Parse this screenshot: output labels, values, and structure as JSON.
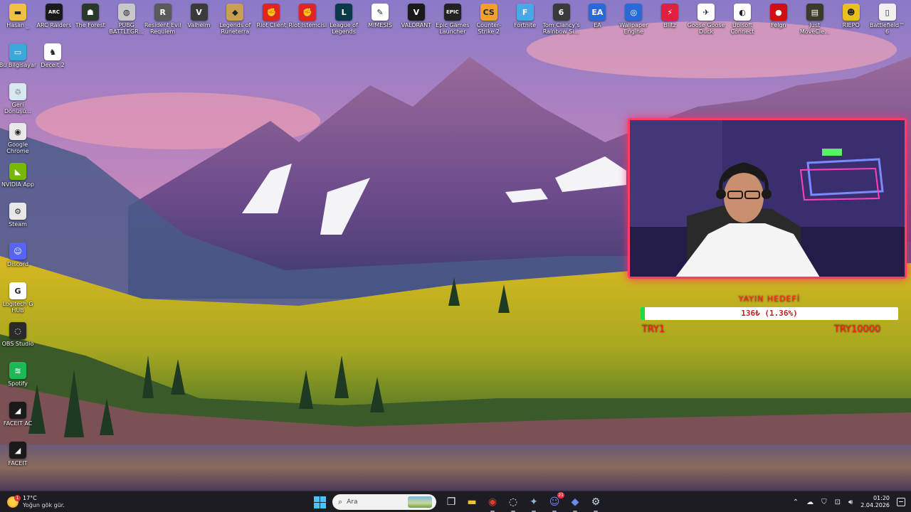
{
  "desktop": {
    "top_row": [
      {
        "label": "Hasan _",
        "icon": "folder-icon",
        "color": "#f0c040",
        "glyph": "▬"
      },
      {
        "label": "ARC Raiders",
        "icon": "arc-raiders-icon",
        "color": "#1a1a1a",
        "glyph": "ARC"
      },
      {
        "label": "The Forest",
        "icon": "the-forest-icon",
        "color": "#2a3a2a",
        "glyph": "☗"
      },
      {
        "label": "PUBG BATTLEGR...",
        "icon": "pubg-icon",
        "color": "#c8c8c8",
        "glyph": "◍"
      },
      {
        "label": "Resident Evil Requiem",
        "icon": "resident-evil-icon",
        "color": "#5a5a5a",
        "glyph": "R"
      },
      {
        "label": "Valheim",
        "icon": "valheim-icon",
        "color": "#3a3a3a",
        "glyph": "V"
      },
      {
        "label": "Legends of Runeterra",
        "icon": "runeterra-icon",
        "color": "#c8a050",
        "glyph": "◆"
      },
      {
        "label": "Riot Client",
        "icon": "riot-client-icon",
        "color": "#e02424",
        "glyph": "✊"
      },
      {
        "label": "Riot Istemcisi",
        "icon": "riot-istemcisi-icon",
        "color": "#e02424",
        "glyph": "✊"
      },
      {
        "label": "League of Legends",
        "icon": "league-icon",
        "color": "#0a3a4a",
        "glyph": "L"
      },
      {
        "label": "MIMESIS",
        "icon": "mimesis-icon",
        "color": "#ffffff",
        "glyph": "✎"
      },
      {
        "label": "VALORANT",
        "icon": "valorant-icon",
        "color": "#1a1a1a",
        "glyph": "V"
      },
      {
        "label": "Epic Games Launcher",
        "icon": "epic-games-icon",
        "color": "#222222",
        "glyph": "EPIC"
      },
      {
        "label": "Counter-Strike 2",
        "icon": "counter-strike-icon",
        "color": "#f0a030",
        "glyph": "CS"
      },
      {
        "label": "Fortnite",
        "icon": "fortnite-icon",
        "color": "#4aa8e8",
        "glyph": "F"
      },
      {
        "label": "Tom Clancy's Rainbow Si...",
        "icon": "rainbow-six-icon",
        "color": "#3a3a3a",
        "glyph": "6"
      },
      {
        "label": "EA",
        "icon": "ea-icon",
        "color": "#2a6ad8",
        "glyph": "EA"
      },
      {
        "label": "Wallpaper Engine",
        "icon": "wallpaper-engine-icon",
        "color": "#2a6ad8",
        "glyph": "◎"
      },
      {
        "label": "Blitz",
        "icon": "blitz-icon",
        "color": "#e02040",
        "glyph": "⚡"
      },
      {
        "label": "Goose Goose Duck",
        "icon": "goose-goose-duck-icon",
        "color": "#ffffff",
        "glyph": "✈"
      },
      {
        "label": "Ubisoft Connect",
        "icon": "ubisoft-icon",
        "color": "#ffffff",
        "glyph": "◐"
      },
      {
        "label": "Felgn",
        "icon": "felgn-icon",
        "color": "#d01010",
        "glyph": "●"
      },
      {
        "label": "Just MoveCle...",
        "icon": "just-move-icon",
        "color": "#3a3a2a",
        "glyph": "▤"
      },
      {
        "label": "RIEPO",
        "icon": "riepo-icon",
        "color": "#e8c020",
        "glyph": "☻"
      },
      {
        "label": "Battlefield™ 6",
        "icon": "battlefield-icon",
        "color": "#f0f0f0",
        "glyph": "▯"
      }
    ],
    "left_column": [
      {
        "label": "Bu Bilgisayar",
        "icon": "this-pc-icon",
        "color": "#3aa8d8",
        "glyph": "▭"
      },
      {
        "label": "Geri Dönüşü...",
        "icon": "recycle-bin-icon",
        "color": "#d8e8f0",
        "glyph": "♲"
      },
      {
        "label": "Google Chrome",
        "icon": "chrome-icon",
        "color": "#e8e8e8",
        "glyph": "◉"
      },
      {
        "label": "NVIDIA App",
        "icon": "nvidia-icon",
        "color": "#76b900",
        "glyph": "◣"
      },
      {
        "label": "Steam",
        "icon": "steam-icon",
        "color": "#e8e8e8",
        "glyph": "⚙"
      },
      {
        "label": "Discord",
        "icon": "discord-icon",
        "color": "#5865f2",
        "glyph": "☺"
      },
      {
        "label": "Logitech G HUB",
        "icon": "logitech-icon",
        "color": "#ffffff",
        "glyph": "G"
      },
      {
        "label": "OBS Studio",
        "icon": "obs-icon",
        "color": "#2a2a2a",
        "glyph": "◌"
      },
      {
        "label": "Spotify",
        "icon": "spotify-icon",
        "color": "#1db954",
        "glyph": "≋"
      },
      {
        "label": "FACEIT AC",
        "icon": "faceit-ac-icon",
        "color": "#1a1a1a",
        "glyph": "◢"
      },
      {
        "label": "FACEIT",
        "icon": "faceit-icon",
        "color": "#1a1a1a",
        "glyph": "◢"
      }
    ],
    "extra": {
      "label": "Deceit 2",
      "icon": "deceit-icon",
      "color": "#ffffff",
      "glyph": "♞"
    }
  },
  "goal": {
    "title": "YAYIN HEDEFİ",
    "text": "136₺ (1.36%)",
    "progress": 0.0136,
    "min": "TRY1",
    "max": "TRY10000"
  },
  "taskbar": {
    "weather": {
      "temp": "17°C",
      "condition": "Yoğun gök gür.",
      "badge": "1"
    },
    "search": {
      "placeholder": "Ara"
    },
    "apps": [
      {
        "name": "task-view-button",
        "glyph": "❐",
        "color": "#e8e8e8"
      },
      {
        "name": "file-explorer-button",
        "glyph": "▬",
        "color": "#f0c040"
      },
      {
        "name": "chrome-taskbar-button",
        "glyph": "◉",
        "color": "#e03a30"
      },
      {
        "name": "obs-taskbar-button",
        "glyph": "◌",
        "color": "#e8e8e8"
      },
      {
        "name": "network-app-button",
        "glyph": "✦",
        "color": "#8ab8d8"
      },
      {
        "name": "discord-taskbar-button",
        "glyph": "☺",
        "color": "#7a86f8",
        "badge": "21"
      },
      {
        "name": "app-diamond-button",
        "glyph": "◆",
        "color": "#6a8ae8"
      },
      {
        "name": "steam-taskbar-button",
        "glyph": "⚙",
        "color": "#c8d8e8"
      }
    ],
    "clock": {
      "time": "01:20",
      "date": "2.04.2026"
    }
  }
}
